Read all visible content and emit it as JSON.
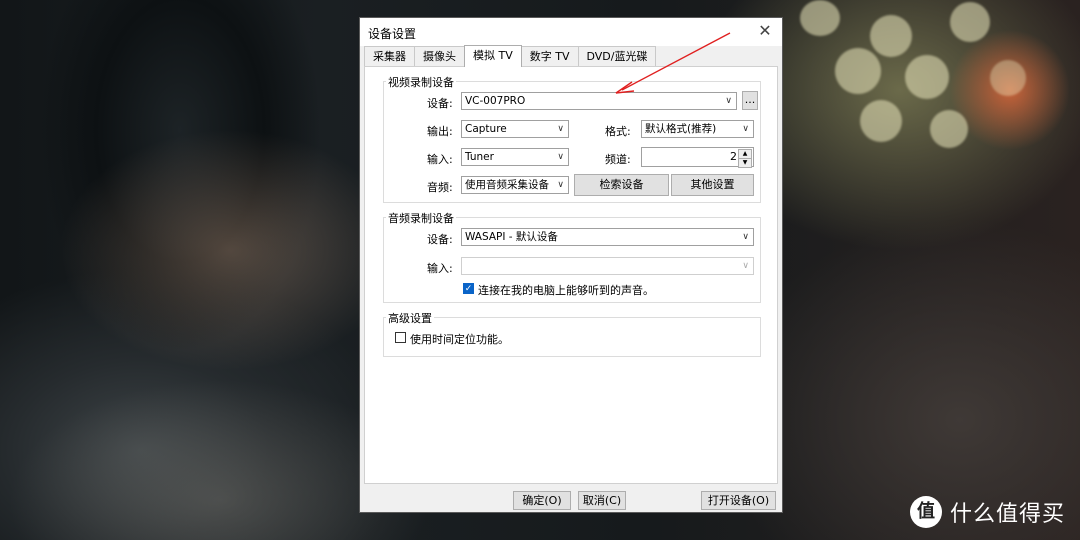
{
  "dialog": {
    "title": "设备设置",
    "close_glyph": "✕",
    "tabs": [
      "采集器",
      "摄像头",
      "模拟 TV",
      "数字 TV",
      "DVD/蓝光碟"
    ],
    "active_tab": "模拟 TV"
  },
  "video": {
    "group_title": "视频录制设备",
    "device_label": "设备:",
    "device_value": "VC-007PRO",
    "browse_label": "...",
    "output_label": "输出:",
    "output_value": "Capture",
    "format_label": "格式:",
    "format_value": "默认格式(推荐)",
    "input_label": "输入:",
    "input_value": "Tuner",
    "channel_label": "频道:",
    "channel_value": "2",
    "audio_label": "音频:",
    "audio_value": "使用音频采集设备",
    "search_button": "检索设备",
    "other_button": "其他设置"
  },
  "audio": {
    "group_title": "音频录制设备",
    "device_label": "设备:",
    "device_value": "WASAPI - 默认设备",
    "input_label": "输入:",
    "input_value": "",
    "loopback_label": "连接在我的电脑上能够听到的声音。",
    "loopback_checked": true
  },
  "advanced": {
    "group_title": "高级设置",
    "timeshift_label": "使用时间定位功能。",
    "timeshift_checked": false
  },
  "footer": {
    "ok": "确定(O)",
    "cancel": "取消(C)",
    "open_device": "打开设备(O)"
  },
  "watermark": {
    "icon_text": "值",
    "text": "什么值得买"
  },
  "colors": {
    "annotation_arrow": "#e02020",
    "checkbox_accent": "#0a64c8"
  }
}
